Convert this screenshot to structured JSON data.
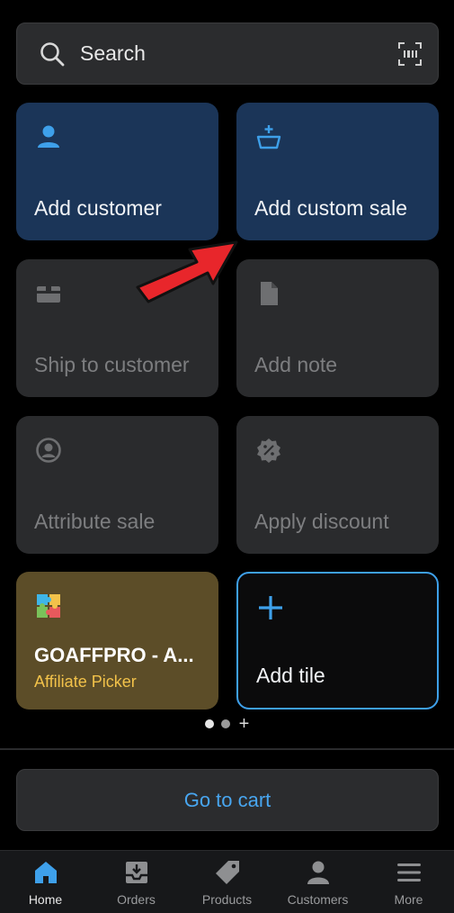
{
  "search": {
    "placeholder": "Search"
  },
  "tiles": [
    {
      "label": "Add customer",
      "icon": "person-icon"
    },
    {
      "label": "Add custom sale",
      "icon": "basket-add-icon"
    },
    {
      "label": "Ship to customer",
      "icon": "shipping-box-icon"
    },
    {
      "label": "Add note",
      "icon": "note-icon"
    },
    {
      "label": "Attribute sale",
      "icon": "account-circle-icon"
    },
    {
      "label": "Apply discount",
      "icon": "discount-badge-icon"
    }
  ],
  "app_tile": {
    "title": "GOAFFPRO - A...",
    "subtitle": "Affiliate Picker",
    "icon": "puzzle-icon"
  },
  "add_tile": {
    "label": "Add tile",
    "icon": "plus-icon"
  },
  "cart": {
    "label": "Go to cart"
  },
  "nav": [
    {
      "label": "Home",
      "icon": "home-icon",
      "active": true
    },
    {
      "label": "Orders",
      "icon": "orders-inbox-icon",
      "active": false
    },
    {
      "label": "Products",
      "icon": "tag-icon",
      "active": false
    },
    {
      "label": "Customers",
      "icon": "person-icon",
      "active": false
    },
    {
      "label": "More",
      "icon": "menu-icon",
      "active": false
    }
  ],
  "colors": {
    "accent": "#48a6f0",
    "tile_blue": "#1b3558",
    "tile_gray": "#2a2b2d",
    "tile_gold": "#5c4d28",
    "highlight_arrow": "#e8262b"
  }
}
